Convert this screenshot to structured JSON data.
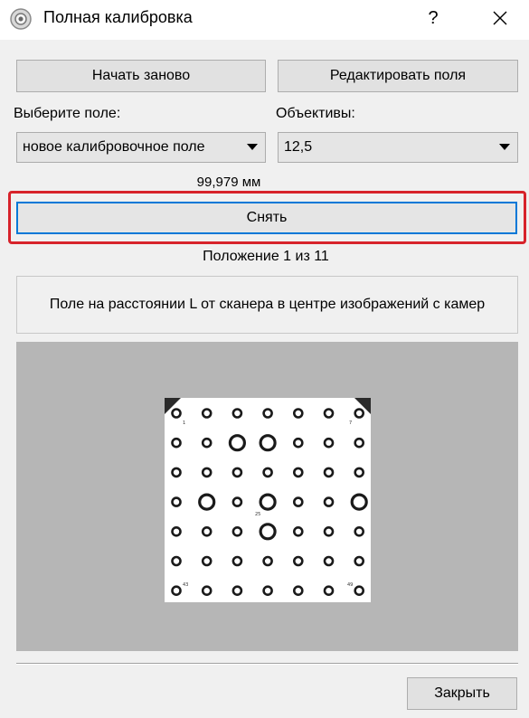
{
  "window": {
    "title": "Полная калибровка",
    "help_label": "?",
    "app_icon": "calibration-app-icon",
    "close_icon": "close-icon"
  },
  "actions": {
    "restart_label": "Начать заново",
    "edit_fields_label": "Редактировать поля"
  },
  "field_select": {
    "label": "Выберите поле:",
    "value": "новое калибровочное поле"
  },
  "lens_select": {
    "label": "Объективы:",
    "value": "12,5"
  },
  "measurement": "99,979 мм",
  "shoot_label": "Снять",
  "position_text": "Положение 1 из 11",
  "instruction": "Поле на расстоянии L от сканера в центре изображений с камер",
  "target": {
    "grid_cols": 7,
    "grid_rows": 7,
    "large_circles": [
      [
        1,
        2
      ],
      [
        1,
        3
      ],
      [
        3,
        1
      ],
      [
        3,
        3
      ],
      [
        3,
        6
      ],
      [
        4,
        3
      ]
    ],
    "labels": [
      "1",
      "7",
      "25",
      "43",
      "49"
    ]
  },
  "footer": {
    "close_label": "Закрыть"
  }
}
